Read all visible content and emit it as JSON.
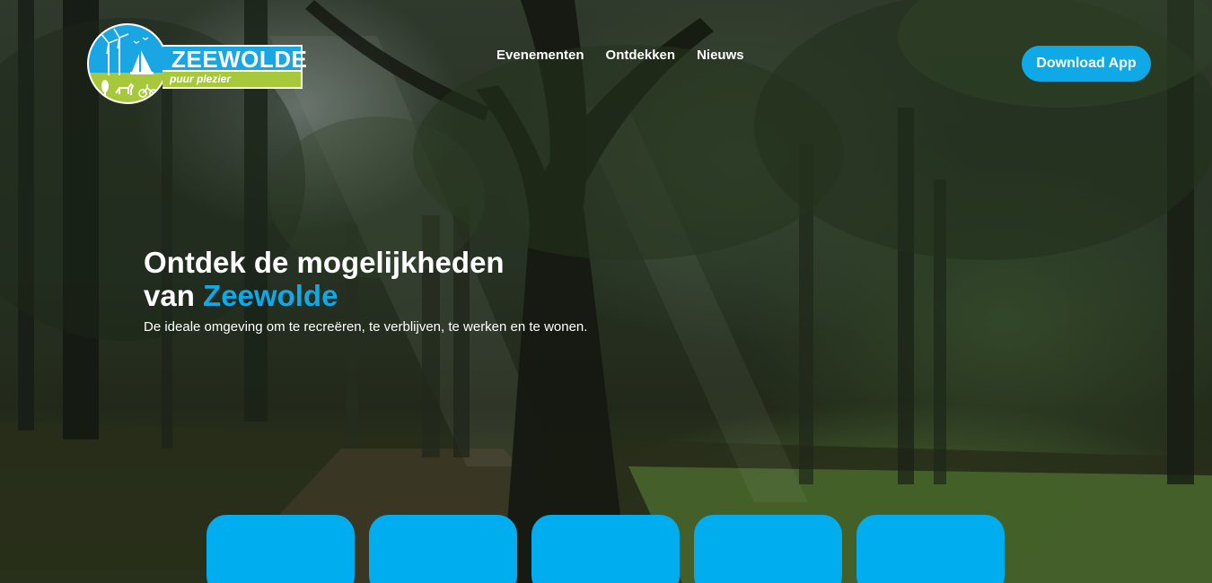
{
  "header": {
    "logo": {
      "brand": "ZEEWOLDE",
      "tagline": "puur plezier",
      "colors": {
        "blue": "#1aa5e3",
        "green": "#a7c83a"
      }
    },
    "nav": [
      {
        "label": "Evenementen"
      },
      {
        "label": "Ontdekken"
      },
      {
        "label": "Nieuws"
      }
    ],
    "cta": {
      "label": "Download App",
      "color": "#10a9e8"
    }
  },
  "hero": {
    "title_line1": "Ontdek de mogelijkheden",
    "title_prefix": "van ",
    "title_accent": "Zeewolde",
    "subtitle": "De ideale omgeving om te recreëren, te verblijven, te werken en te wonen."
  },
  "cards": [
    {
      "color": "#00adef"
    },
    {
      "color": "#00adef"
    },
    {
      "color": "#00adef"
    },
    {
      "color": "#00adef"
    },
    {
      "color": "#00adef"
    }
  ]
}
